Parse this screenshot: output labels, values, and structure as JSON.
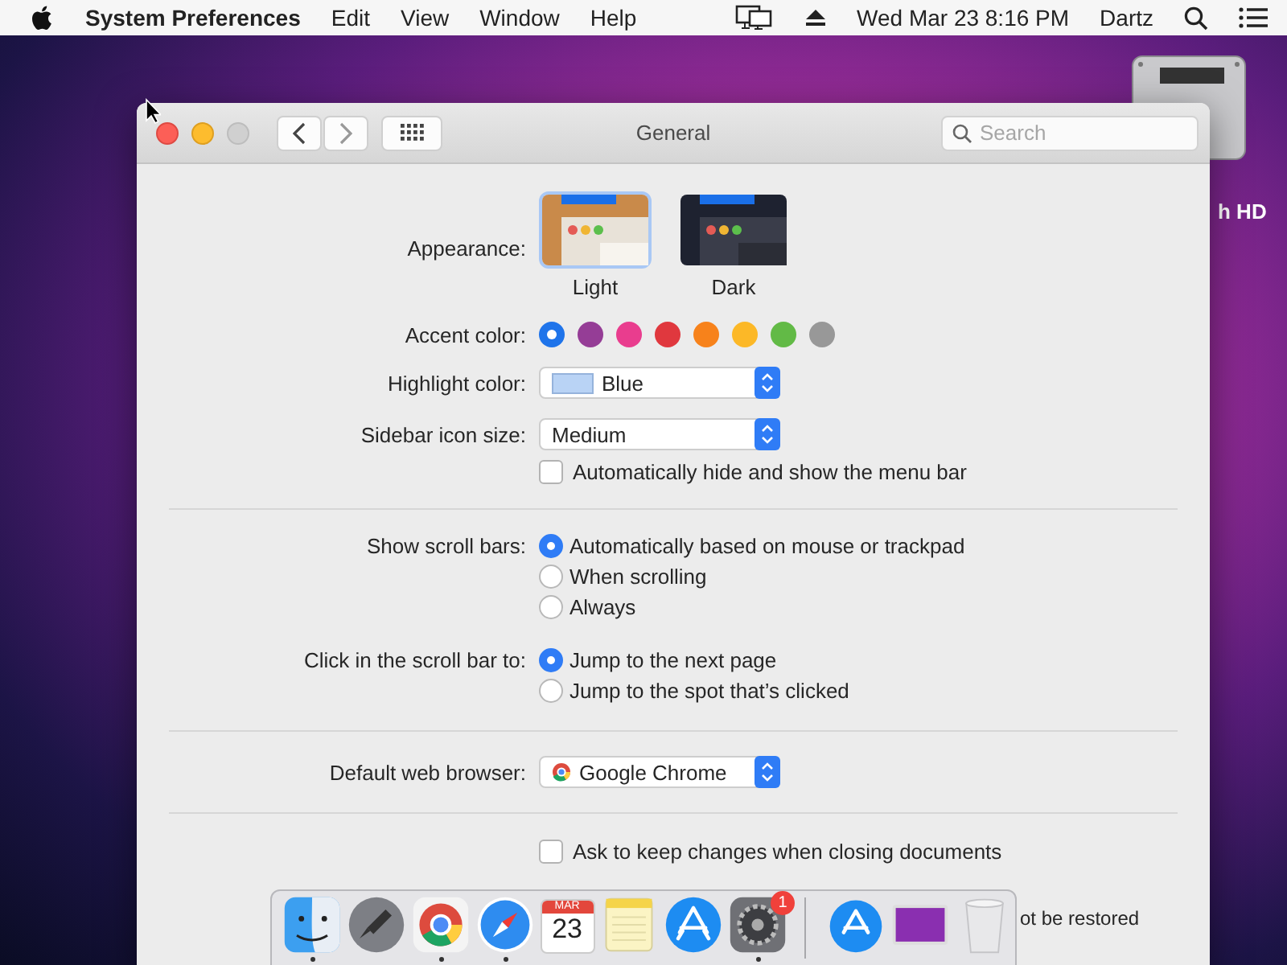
{
  "menu_bar": {
    "app_name": "System Preferences",
    "menus": [
      "Edit",
      "View",
      "Window",
      "Help"
    ],
    "clock": "Wed Mar 23  8:16 PM",
    "user": "Dartz"
  },
  "desktop": {
    "disk_label": "h HD"
  },
  "window": {
    "title": "General",
    "search": {
      "placeholder": "Search"
    },
    "appearance": {
      "label": "Appearance:",
      "options": [
        {
          "label": "Light",
          "kind": "light",
          "selected": true
        },
        {
          "label": "Dark",
          "kind": "dark",
          "selected": false
        }
      ]
    },
    "accent": {
      "label": "Accent color:",
      "colors": [
        {
          "color": "#1f74ea",
          "selected": true
        },
        {
          "color": "#953d96",
          "selected": false
        },
        {
          "color": "#e93d8e",
          "selected": false
        },
        {
          "color": "#e0383e",
          "selected": false
        },
        {
          "color": "#f7821b",
          "selected": false
        },
        {
          "color": "#fcb827",
          "selected": false
        },
        {
          "color": "#62ba46",
          "selected": false
        },
        {
          "color": "#989898",
          "selected": false
        }
      ]
    },
    "highlight": {
      "label": "Highlight color:",
      "value": "Blue"
    },
    "sidebar_size": {
      "label": "Sidebar icon size:",
      "value": "Medium"
    },
    "menu_bar_autohide": {
      "label": "Automatically hide and show the menu bar",
      "checked": false
    },
    "scroll_bars": {
      "label": "Show scroll bars:",
      "options": [
        {
          "label": "Automatically based on mouse or trackpad",
          "selected": true
        },
        {
          "label": "When scrolling",
          "selected": false
        },
        {
          "label": "Always",
          "selected": false
        }
      ]
    },
    "scroll_click": {
      "label": "Click in the scroll bar to:",
      "options": [
        {
          "label": "Jump to the next page",
          "selected": true
        },
        {
          "label": "Jump to the spot that’s clicked",
          "selected": false
        }
      ]
    },
    "browser": {
      "label": "Default web browser:",
      "value": "Google Chrome"
    },
    "keep_changes": {
      "label": "Ask to keep changes when closing documents",
      "checked": false
    },
    "partial_text": "ot be restored"
  },
  "dock": {
    "items": [
      {
        "kind": "finder",
        "running": true
      },
      {
        "kind": "launchpad",
        "running": false
      },
      {
        "kind": "chrome",
        "running": true
      },
      {
        "kind": "safari",
        "running": true
      },
      {
        "kind": "calendar",
        "running": false,
        "month": "MAR",
        "day": "23"
      },
      {
        "kind": "notes",
        "running": false
      },
      {
        "kind": "appstore",
        "running": false
      },
      {
        "kind": "settings",
        "running": true,
        "badge": "1"
      },
      {
        "kind": "separator"
      },
      {
        "kind": "download",
        "running": false
      },
      {
        "kind": "photo",
        "running": false
      },
      {
        "kind": "trash",
        "running": false
      }
    ]
  }
}
